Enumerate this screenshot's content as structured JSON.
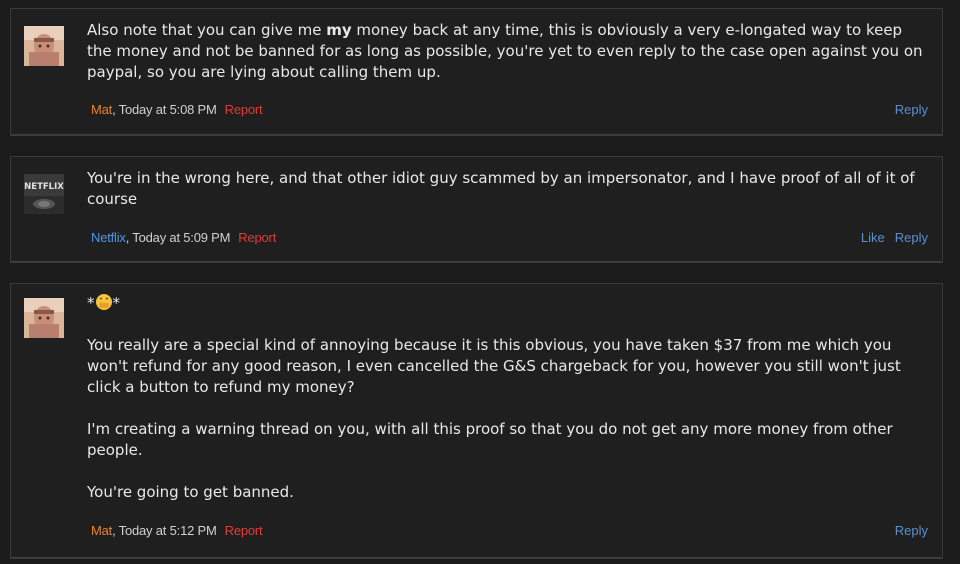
{
  "posts": [
    {
      "message_before": "Also note that you can give me ",
      "message_bold": "my",
      "message_after": " money back at any time, this is obviously a very e-longated way to keep the money and not be banned for as long as possible, you're yet to even reply to the case open against you on paypal, so you are lying about calling them up.",
      "author": "Mat",
      "time": ", Today at 5:08 PM",
      "report_label": "Report",
      "reply_label": "Reply"
    },
    {
      "avatar_text": "NETFLIX",
      "message": "You're in the wrong here, and that other idiot guy scammed by an impersonator, and I have proof of all of it of course",
      "author": "Netflix",
      "time": ", Today at 5:09 PM",
      "report_label": "Report",
      "like_label": "Like",
      "reply_label": "Reply"
    },
    {
      "emoji_line_prefix": "*",
      "emoji_line_suffix": "*",
      "paragraphs": [
        "You really are a special kind of annoying because it is this obvious, you have taken $37 from me which you won't refund for any good reason, I even cancelled the G&S chargeback for you, however you still won't just click a button to refund my money?",
        "I'm creating a warning thread on you, with all this proof so that you do not get any more money from other people.",
        "You're going to get banned."
      ],
      "author": "Mat",
      "time": ", Today at 5:12 PM",
      "report_label": "Report",
      "reply_label": "Reply"
    }
  ],
  "colors": {
    "background": "#1b1b1b",
    "post_background": "#1f1f1f",
    "text": "#e8e8e8",
    "author_mat": "#e8842c",
    "author_netflix": "#4f96e8",
    "report": "#e23a3a",
    "action_link": "#5a8fd0"
  },
  "icons": {
    "emoji": "face-with-hand-over-mouth-emoji"
  }
}
